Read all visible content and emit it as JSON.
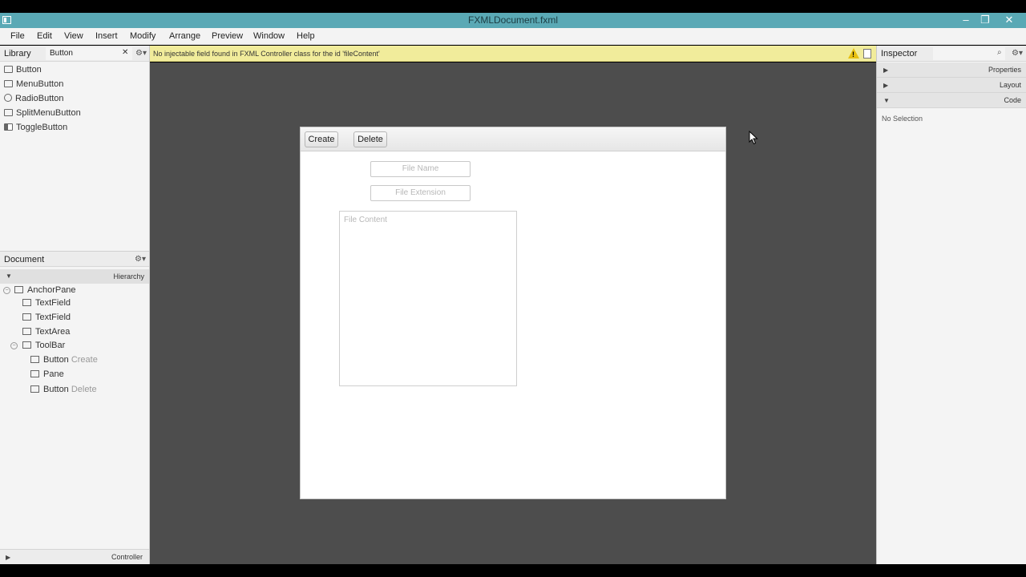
{
  "window": {
    "title": "FXMLDocument.fxml",
    "minimize_glyph": "–",
    "maximize_glyph": "❐",
    "close_glyph": "✕"
  },
  "menu": [
    "File",
    "Edit",
    "View",
    "Insert",
    "Modify",
    "Arrange",
    "Preview",
    "Window",
    "Help"
  ],
  "library": {
    "title": "Library",
    "search_value": "Button",
    "clear_glyph": "✕",
    "gear_glyph": "⚙▾",
    "items": [
      "Button",
      "MenuButton",
      "RadioButton",
      "SplitMenuButton",
      "ToggleButton"
    ]
  },
  "document": {
    "title": "Document",
    "gear_glyph": "⚙▾",
    "hierarchy_label": "Hierarchy",
    "tree": [
      {
        "label": "AnchorPane",
        "sub": ""
      },
      {
        "label": "TextField",
        "sub": ""
      },
      {
        "label": "TextField",
        "sub": ""
      },
      {
        "label": "TextArea",
        "sub": ""
      },
      {
        "label": "ToolBar",
        "sub": ""
      },
      {
        "label": "Button",
        "sub": "Create"
      },
      {
        "label": "Pane",
        "sub": ""
      },
      {
        "label": "Button",
        "sub": "Delete"
      }
    ],
    "controller_label": "Controller"
  },
  "warning": {
    "message": "No injectable field found in FXML Controller class for the id 'fileContent'"
  },
  "form": {
    "create_label": "Create",
    "delete_label": "Delete",
    "file_name_placeholder": "File Name",
    "file_extension_placeholder": "File Extension",
    "file_content_placeholder": "File Content"
  },
  "inspector": {
    "title": "Inspector",
    "gear_glyph": "⚙▾",
    "sections": [
      "Properties",
      "Layout",
      "Code"
    ],
    "no_selection": "No Selection"
  },
  "colors": {
    "titlebar": "#5aa9b5",
    "warning": "#f1ec9b",
    "canvas": "#4d4d4d"
  }
}
